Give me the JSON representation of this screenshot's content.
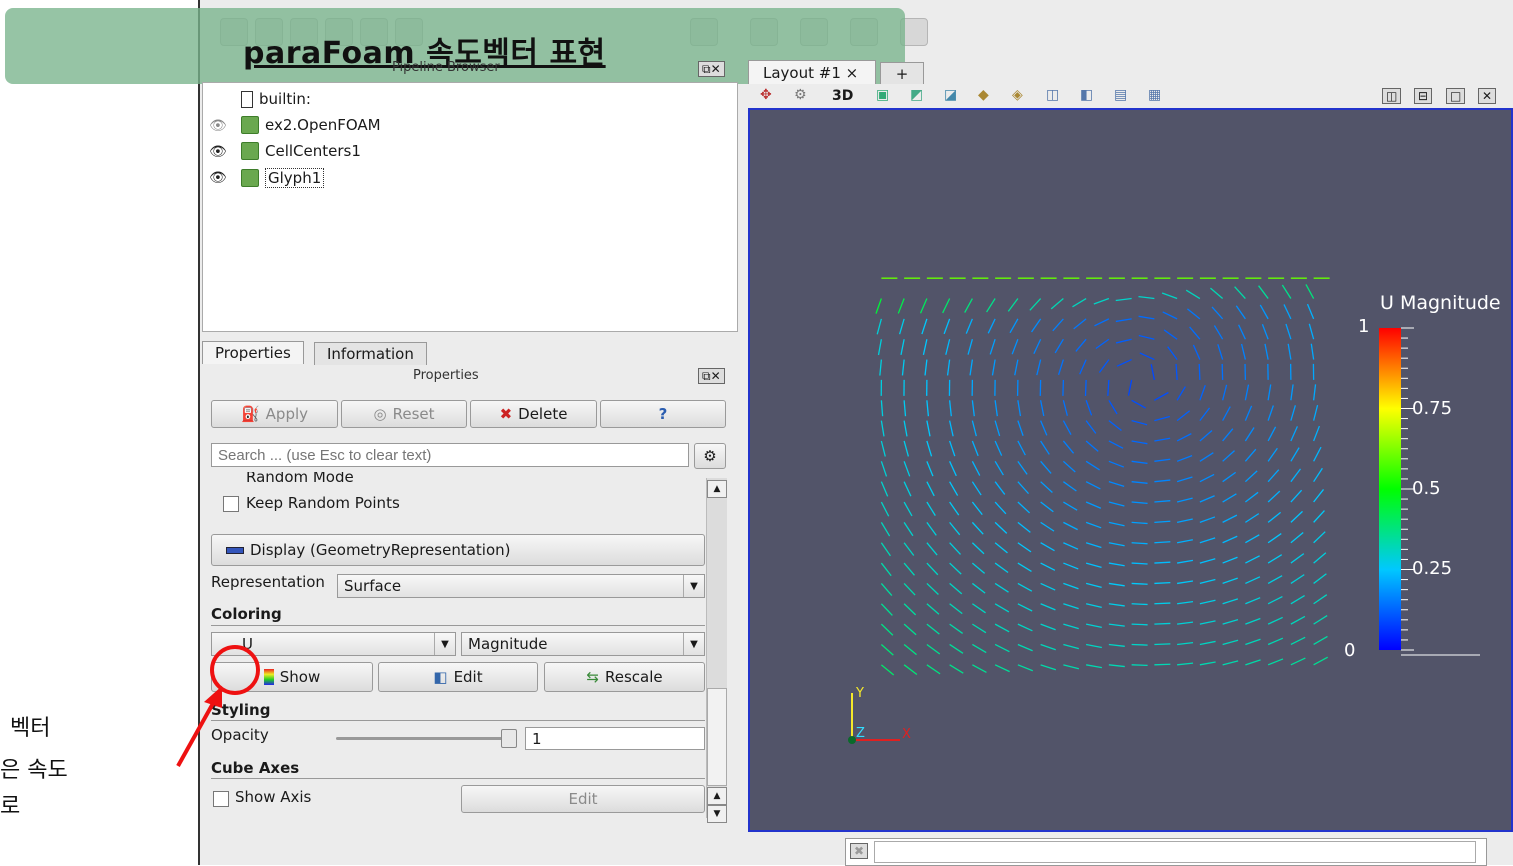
{
  "banner": {
    "title": "paraFoam 속도벡터 표현"
  },
  "pipeline": {
    "title": "Pipeline Browser",
    "items": [
      {
        "label": "builtin:"
      },
      {
        "label": "ex2.OpenFOAM"
      },
      {
        "label": "CellCenters1"
      },
      {
        "label": "Glyph1"
      }
    ]
  },
  "tabs": {
    "properties": "Properties",
    "information": "Information"
  },
  "properties": {
    "title": "Properties",
    "apply": "Apply",
    "reset": "Reset",
    "delete": "Delete",
    "help": "?",
    "search_placeholder": "Search ... (use Esc to clear text)",
    "random_mode": "Random Mode",
    "keep_random_points": "Keep Random Points",
    "display_header": "Display (GeometryRepresentation)",
    "representation_label": "Representation",
    "representation_value": "Surface",
    "coloring_section": "Coloring",
    "coloring_array": "U",
    "coloring_component": "Magnitude",
    "show": "Show",
    "edit": "Edit",
    "rescale": "Rescale",
    "styling_section": "Styling",
    "opacity_label": "Opacity",
    "opacity_value": "1",
    "opacity_level": 1.0,
    "cube_axes_section": "Cube Axes",
    "show_axis": "Show Axis",
    "axis_edit": "Edit"
  },
  "layout": {
    "tab": "Layout #1 ×",
    "plus": "+",
    "mode_3d": "3D"
  },
  "view": {
    "legend_title": "U Magnitude",
    "legend_ticks": [
      "1",
      "0.75",
      "0.5",
      "0.25",
      "0"
    ],
    "axes": {
      "x": "X",
      "y": "Y",
      "z": "Z"
    }
  },
  "annotation": {
    "lines": [
      "벡터",
      "은 속도",
      "로"
    ]
  },
  "colors": {
    "banner": "#78b48c",
    "view_bg": "#525469",
    "annotation": "#ee1111"
  }
}
